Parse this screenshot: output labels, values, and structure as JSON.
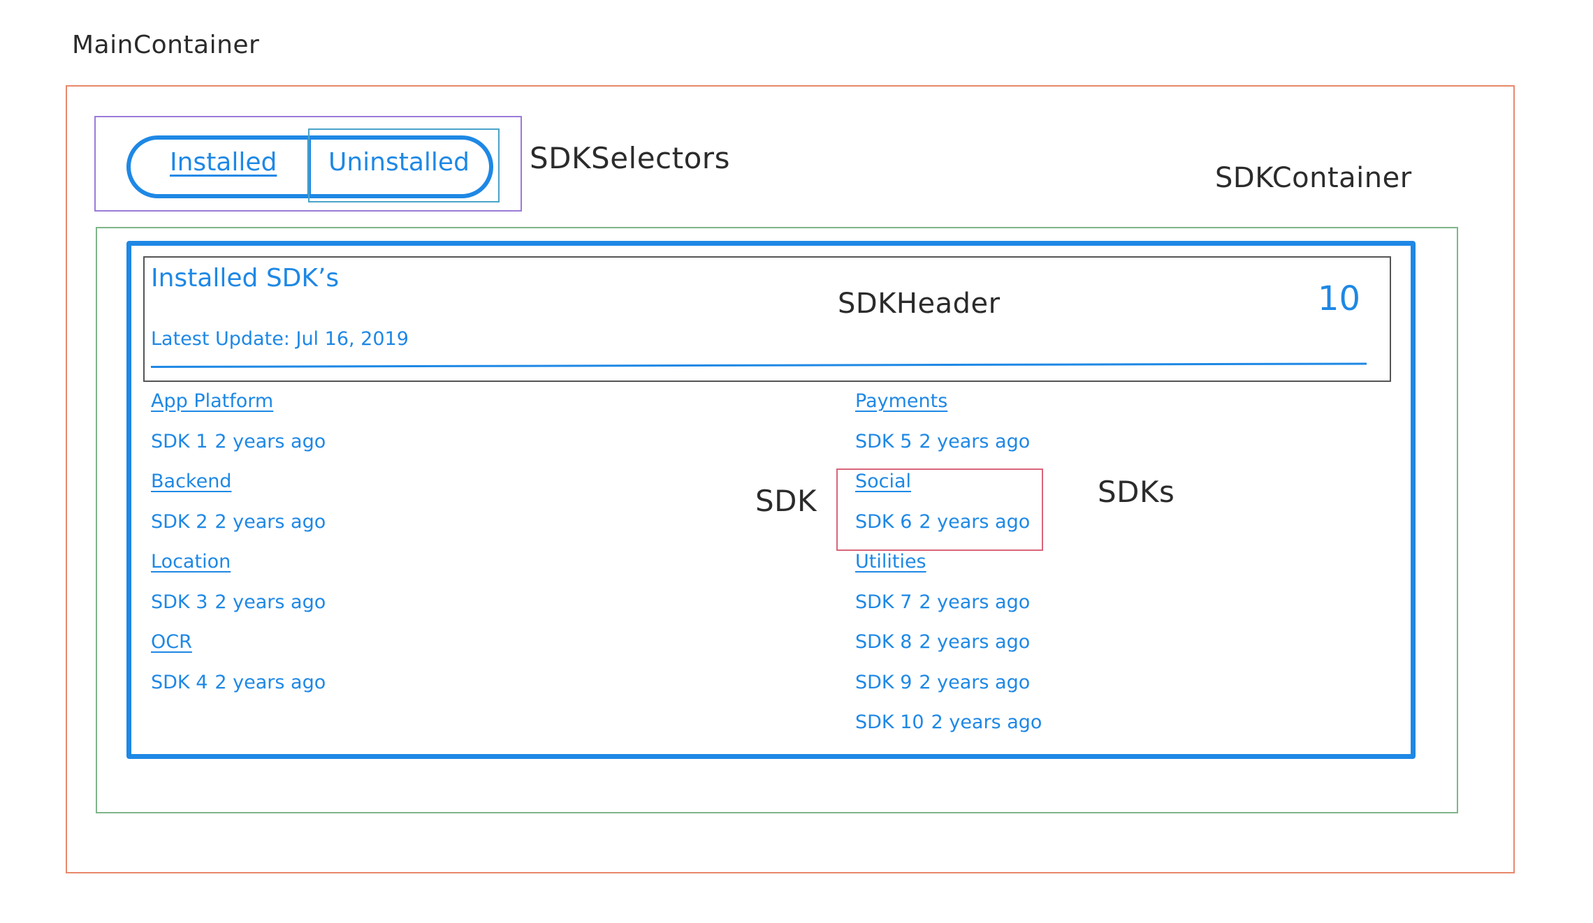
{
  "annotations": {
    "main_container": "MainContainer",
    "sdk_selectors": "SDKSelectors",
    "sdk_container": "SDKContainer",
    "sdk_header": "SDKHeader",
    "sdk": "SDK",
    "sdks": "SDKs"
  },
  "selectors": {
    "installed_label": "Installed",
    "uninstalled_label": "Uninstalled",
    "active": "Installed"
  },
  "header": {
    "title": "Installed SDK’s",
    "latest_update": "Latest Update: Jul 16, 2019",
    "count": "10"
  },
  "columns": [
    {
      "items": [
        {
          "kind": "category",
          "label": "App Platform"
        },
        {
          "kind": "sdk",
          "name": "SDK 1",
          "age": "2 years ago"
        },
        {
          "kind": "category",
          "label": "Backend"
        },
        {
          "kind": "sdk",
          "name": "SDK 2",
          "age": "2 years ago"
        },
        {
          "kind": "category",
          "label": "Location"
        },
        {
          "kind": "sdk",
          "name": "SDK 3",
          "age": "2 years ago"
        },
        {
          "kind": "category",
          "label": "OCR"
        },
        {
          "kind": "sdk",
          "name": "SDK 4",
          "age": "2 years ago"
        }
      ]
    },
    {
      "items": [
        {
          "kind": "category",
          "label": "Payments"
        },
        {
          "kind": "sdk",
          "name": "SDK 5",
          "age": "2 years ago"
        },
        {
          "kind": "category",
          "label": "Social"
        },
        {
          "kind": "sdk",
          "name": "SDK 6",
          "age": "2 years ago"
        },
        {
          "kind": "category",
          "label": "Utilities"
        },
        {
          "kind": "sdk",
          "name": "SDK 7",
          "age": "2 years ago"
        },
        {
          "kind": "sdk",
          "name": "SDK 8",
          "age": "2 years ago"
        },
        {
          "kind": "sdk",
          "name": "SDK 9",
          "age": "2 years ago"
        },
        {
          "kind": "sdk",
          "name": "SDK 10",
          "age": "2 years ago"
        }
      ]
    }
  ],
  "colors": {
    "accent": "#1e88e5",
    "main_container_border": "#e8886b",
    "selectors_border": "#9b7bd9",
    "sdk_container_border": "#7fb58a",
    "sdk_highlight_border": "#d9667a",
    "annotation_text": "#2b2b2b"
  }
}
